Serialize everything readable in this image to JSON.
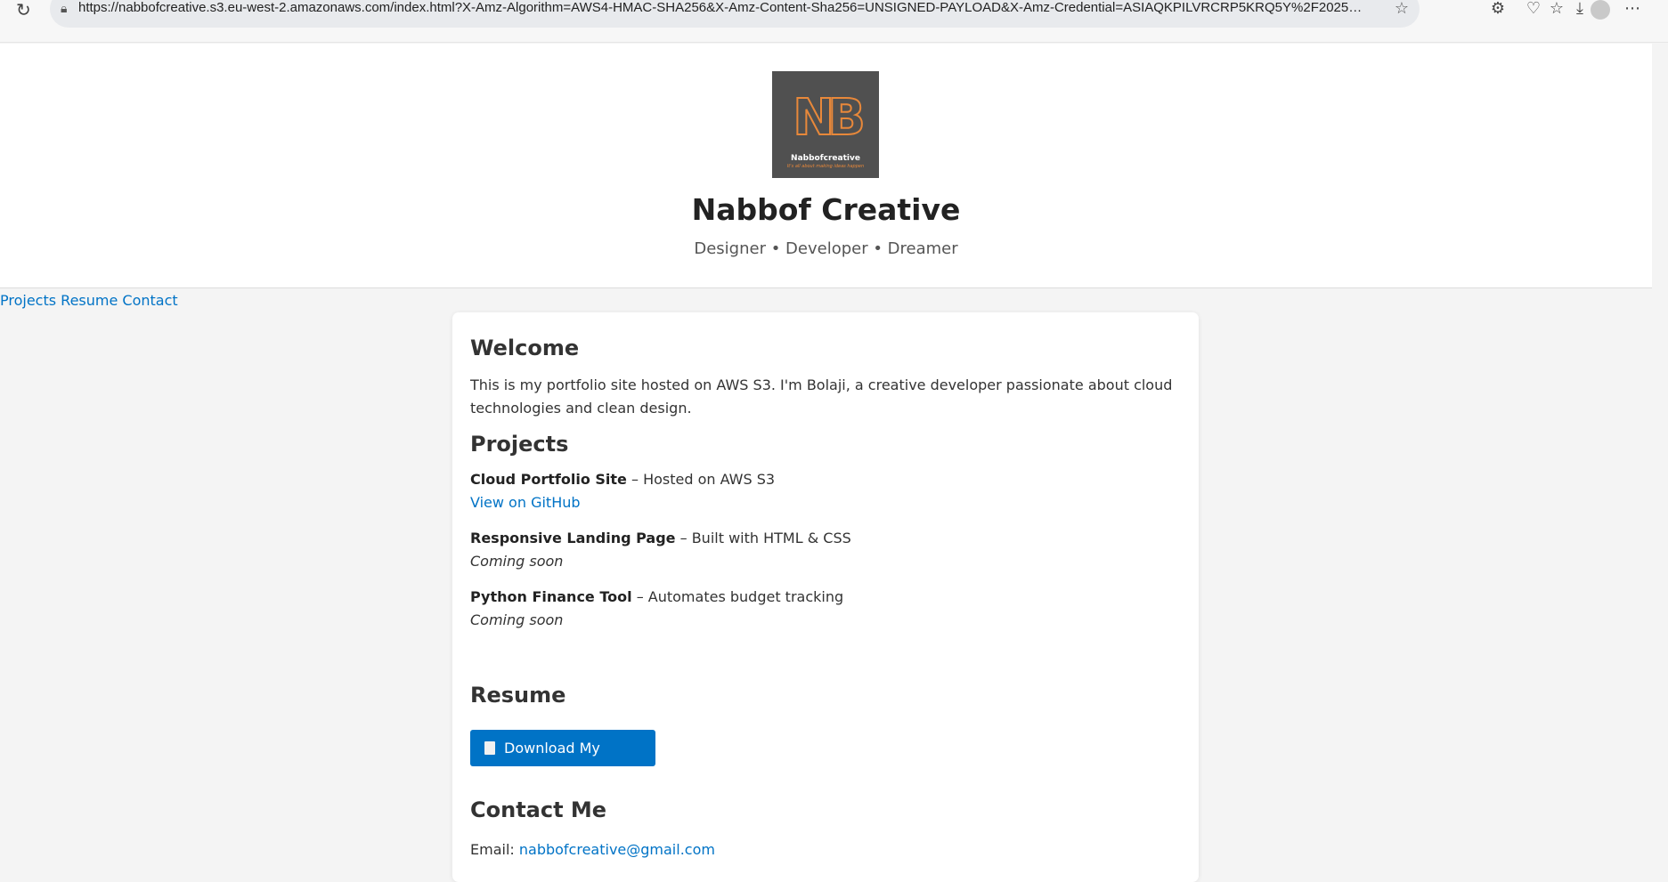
{
  "browser": {
    "url": "https://nabbofcreative.s3.eu-west-2.amazonaws.com/index.html?X-Amz-Algorithm=AWS4-HMAC-SHA256&X-Amz-Content-Sha256=UNSIGNED-PAYLOAD&X-Amz-Credential=ASIAQKPILVRCRP5KRQ5Y%2F20250922%2Feu-west-2%2Fs3%2Fa..."
  },
  "header": {
    "logo_mark": "NB",
    "logo_name": "Nabbofcreative",
    "logo_tagline": "It's all about making ideas happen",
    "title": "Nabbof Creative",
    "tagline": "Designer • Developer • Dreamer"
  },
  "nav": {
    "projects": "Projects",
    "resume": "Resume",
    "contact": "Contact"
  },
  "welcome": {
    "heading": "Welcome",
    "text": "This is my portfolio site hosted on AWS S3. I'm Bolaji, a creative developer passionate about cloud technologies and clean design."
  },
  "projects": {
    "heading": "Projects",
    "items": [
      {
        "name": "Cloud Portfolio Site",
        "desc": " – Hosted on AWS S3",
        "link": "View on GitHub"
      },
      {
        "name": "Responsive Landing Page",
        "desc": " – Built with HTML & CSS",
        "status": "Coming soon"
      },
      {
        "name": "Python Finance Tool",
        "desc": " – Automates budget tracking",
        "status": "Coming soon"
      }
    ]
  },
  "resume": {
    "heading": "Resume",
    "button": "Download My Resume"
  },
  "contact": {
    "heading": "Contact Me",
    "email_label": "Email: ",
    "email": "nabbofcreative@gmail.com"
  },
  "colors": {
    "link": "#0073c6",
    "logo_bg": "#505050",
    "logo_accent": "#e8883a"
  }
}
